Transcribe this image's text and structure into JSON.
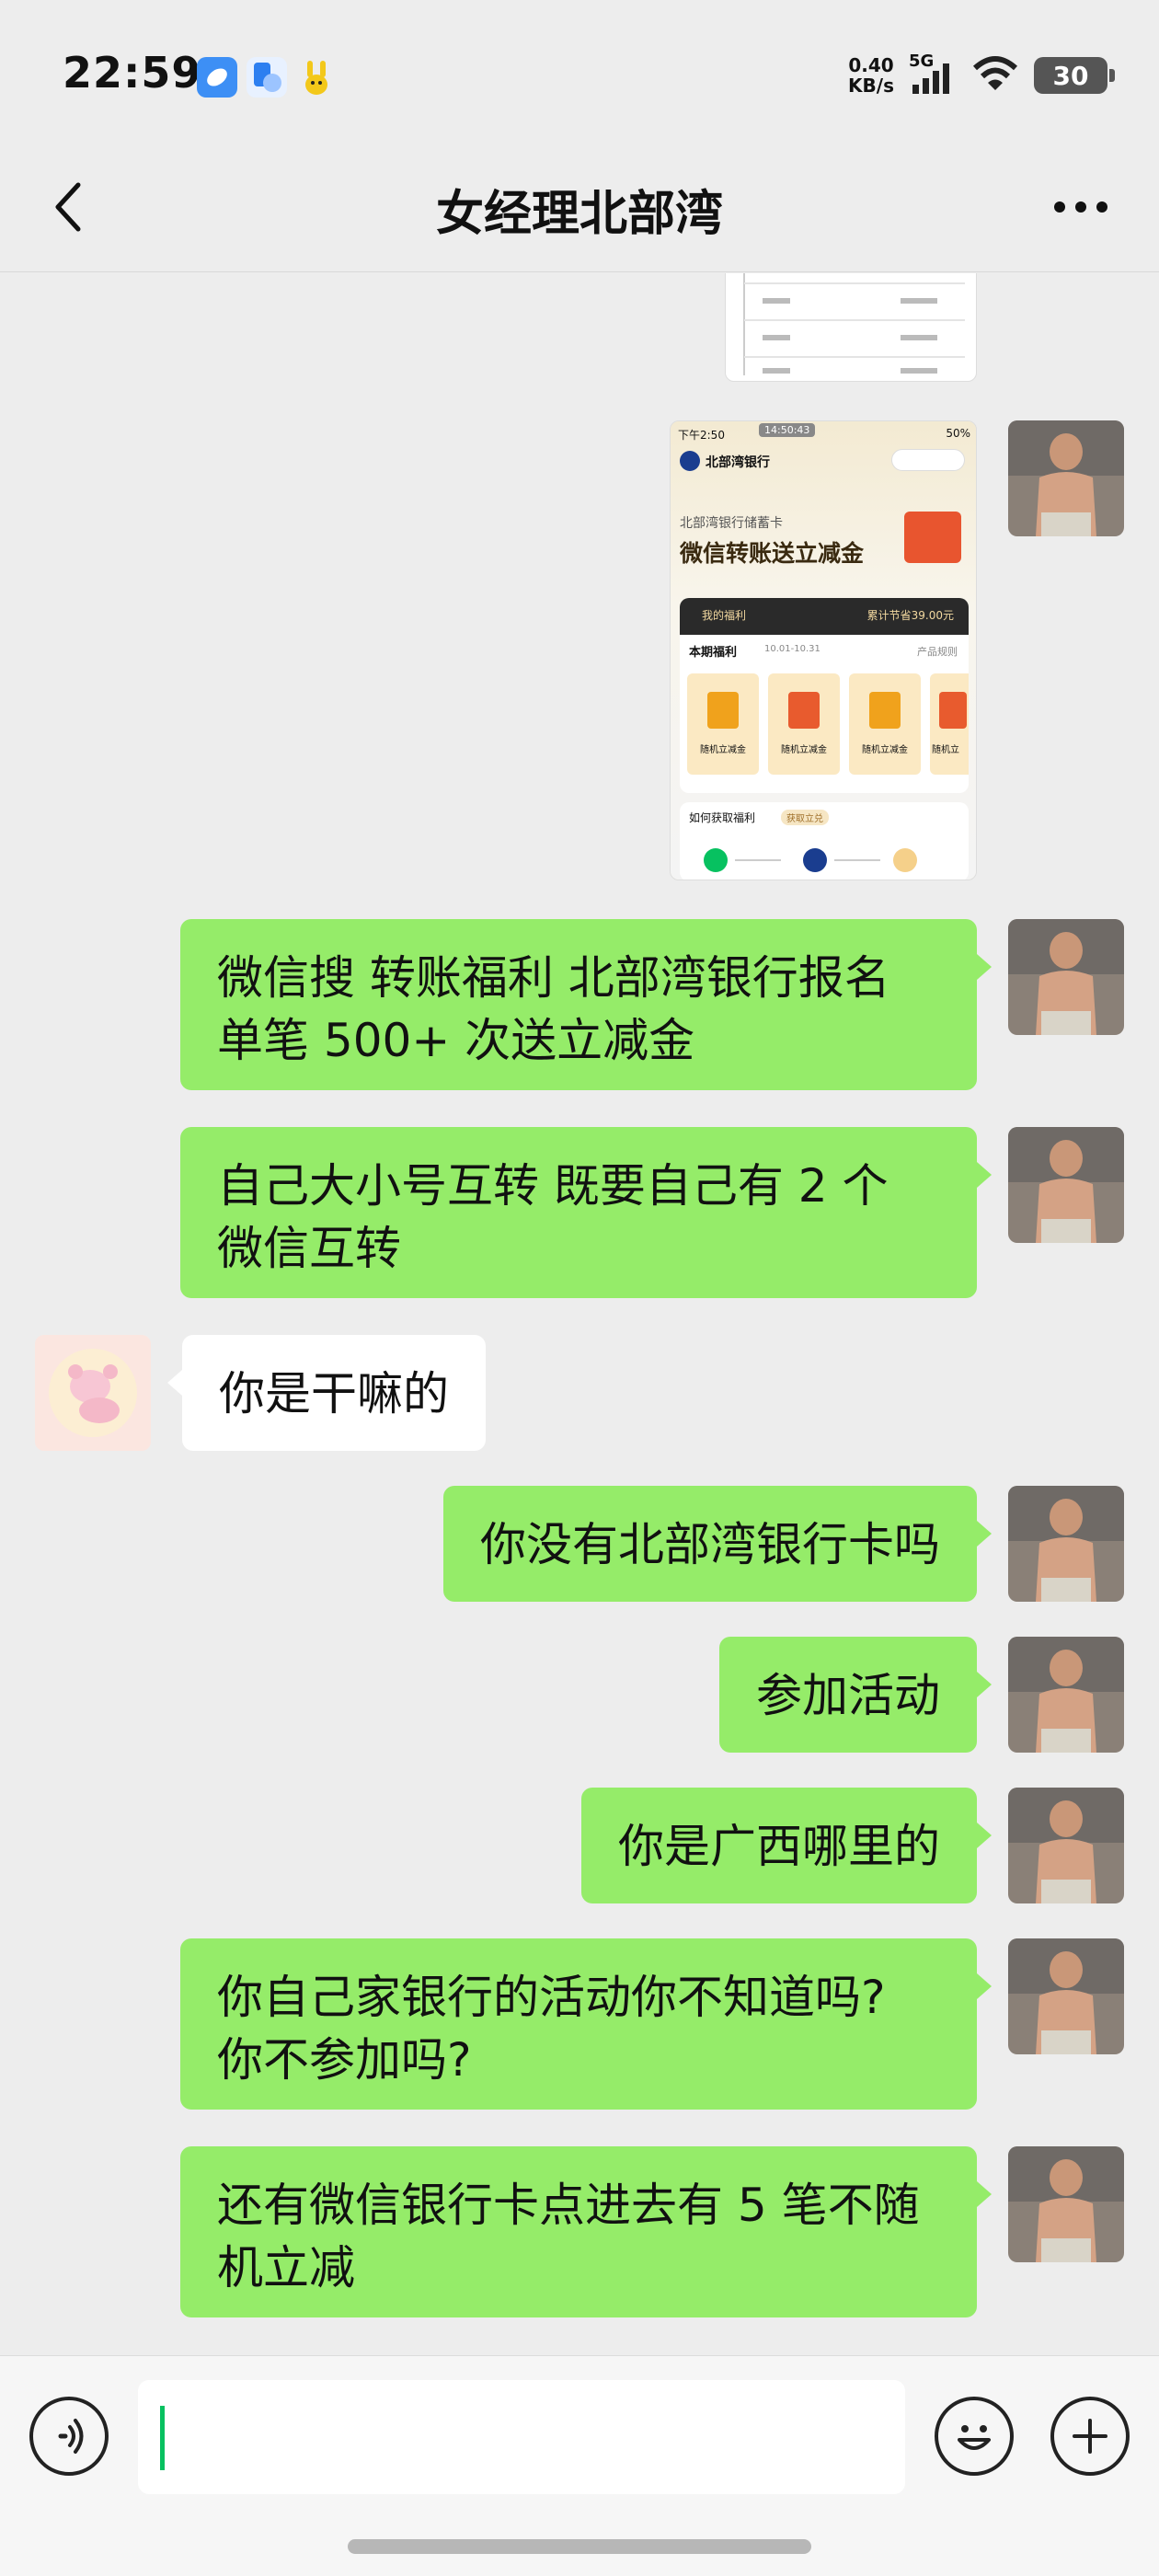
{
  "status_bar": {
    "time": "22:59",
    "net_speed_value": "0.40",
    "net_speed_unit": "KB/s",
    "signal_label": "5G",
    "battery": "30"
  },
  "nav": {
    "title": "女经理北部湾"
  },
  "bank_card_image": {
    "time": "下午2:50",
    "clock_badge": "14:50:43",
    "status_right": "50%",
    "bank_name": "北部湾银行",
    "bank_sub": "北部湾银行储蓄卡",
    "headline": "微信转账送立减金",
    "benefit_label": "我的福利",
    "benefit_total": "累计节省39.00元",
    "period_label": "本期福利",
    "period_dates": "10.01-10.31",
    "rules_link": "产品规则",
    "coupons": [
      "随机立减金",
      "随机立减金",
      "随机立减金",
      "随机立"
    ],
    "how_to": "如何获取福利",
    "how_to_badge": "获取立兑"
  },
  "messages": [
    {
      "side": "me",
      "text": "微信搜 转账福利 北部湾银行报名\n单笔 500+ 次送立减金"
    },
    {
      "side": "me",
      "text": "自己大小号互转 既要自己有 2 个\n微信互转"
    },
    {
      "side": "other",
      "text": "你是干嘛的"
    },
    {
      "side": "me",
      "text": "你没有北部湾银行卡吗"
    },
    {
      "side": "me",
      "text": "参加活动"
    },
    {
      "side": "me",
      "text": "你是广西哪里的"
    },
    {
      "side": "me",
      "text": "你自己家银行的活动你不知道吗?\n你不参加吗?"
    },
    {
      "side": "me",
      "text": "还有微信银行卡点进去有 5 笔不随\n机立减"
    }
  ],
  "input": {
    "placeholder": ""
  },
  "colors": {
    "my_bubble": "#95ec69",
    "other_bubble": "#ffffff",
    "background": "#ededed",
    "cursor": "#07c160"
  }
}
